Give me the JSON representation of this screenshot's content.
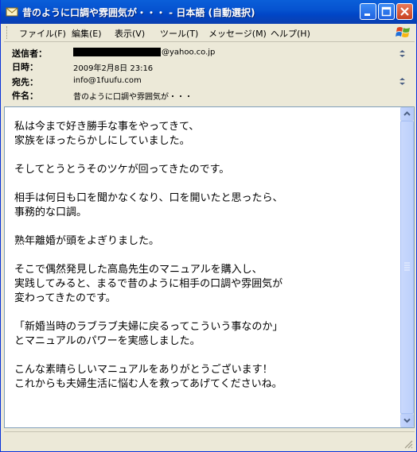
{
  "window": {
    "title": "昔のように口調や雰囲気が・・・ - 日本語 (自動選択)"
  },
  "menu": {
    "items": [
      "ファイル(F)",
      "編集(E)",
      "表示(V)",
      "ツール(T)",
      "メッセージ(M)",
      "ヘルプ(H)"
    ]
  },
  "header": {
    "from_label": "送信者：",
    "from_value": "@yahoo.co.jp",
    "date_label": "日時：",
    "date_value": "2009年2月8日 23:16",
    "to_label": "宛先：",
    "to_value": "info@1fuufu.com",
    "subject_label": "件名：",
    "subject_value": "昔のように口調や雰囲気が・・・"
  },
  "message": {
    "body": "私は今まで好き勝手な事をやってきて、\n家族をほったらかしにしていました。\n\nそしてとうとうそのツケが回ってきたのです。\n\n相手は何日も口を聞かなくなり、口を開いたと思ったら、\n事務的な口調。\n\n熟年離婚が頭をよぎりました。\n\nそこで偶然発見した高島先生のマニュアルを購入し、\n実践してみると、まるで昔のように相手の口調や雰囲気が\n変わってきたのです。\n\n「新婚当時のラブラブ夫婦に戻るってこういう事なのか」\nとマニュアルのパワーを実感しました。\n\nこんな素晴らしいマニュアルをありがとうございます！\nこれからも夫婦生活に悩む人を救ってあげてくださいね。"
  },
  "icons": {
    "app": "envelope-icon",
    "minimize": "minimize-icon",
    "maximize": "maximize-icon",
    "close": "close-icon",
    "windows_logo": "windows-logo-icon"
  }
}
